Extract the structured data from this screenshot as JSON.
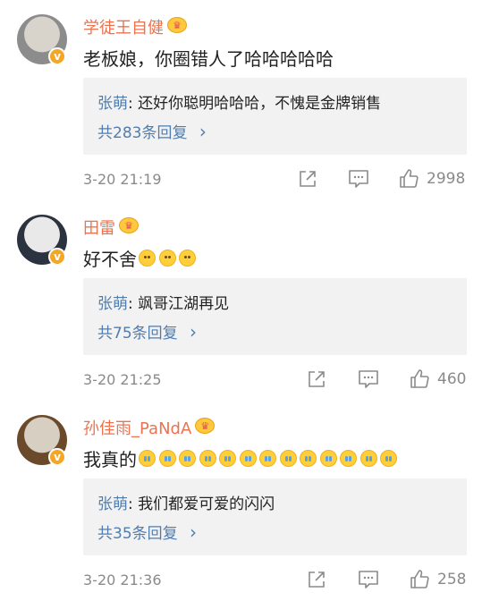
{
  "comments": [
    {
      "username": "学徒王自健",
      "text": "老板娘，你圈错人了哈哈哈哈哈",
      "emoji_count": 0,
      "emoji_icon": "",
      "reply_author": "张萌",
      "reply_sep": ": ",
      "reply_text": "还好你聪明哈哈哈，不愧是金牌销售",
      "reply_count_label": "共283条回复",
      "time": "3-20 21:19",
      "likes": "2998"
    },
    {
      "username": "田雷",
      "text": "好不舍",
      "emoji_count": 3,
      "emoji_icon": "sad-face-emoji",
      "reply_author": "张萌",
      "reply_sep": ": ",
      "reply_text": "飒哥江湖再见",
      "reply_count_label": "共75条回复",
      "time": "3-20 21:25",
      "likes": "460"
    },
    {
      "username": "孙佳雨_PaNdA",
      "text": "我真的",
      "emoji_count": 13,
      "emoji_icon": "crying-face-emoji",
      "reply_author": "张萌",
      "reply_sep": ": ",
      "reply_text": "我们都爱可爱的闪闪",
      "reply_count_label": "共35条回复",
      "time": "3-20 21:36",
      "likes": "258"
    }
  ],
  "icons": {
    "verified": "verified-badge-icon",
    "member": "crown-member-icon",
    "share": "share-icon",
    "comment": "comment-icon",
    "like": "thumbs-up-icon",
    "chevron": "chevron-right-icon"
  },
  "colors": {
    "username": "#eb7350",
    "reply_link": "#507daf",
    "reply_bg": "#f2f2f2",
    "meta": "#8a8a8a",
    "verified": "#f5a623"
  },
  "chevron_glyph": "›"
}
